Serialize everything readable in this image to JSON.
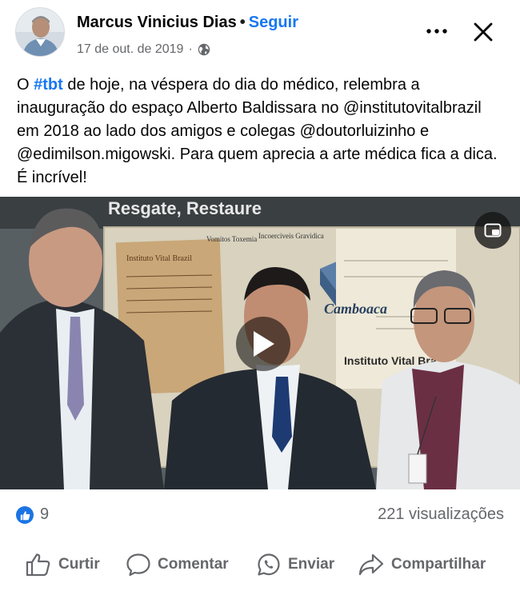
{
  "post": {
    "author": "Marcus Vinicius Dias",
    "separator": "•",
    "follow_label": "Seguir",
    "date": "17 de out. de 2019",
    "date_separator": "·",
    "privacy_icon": "globe-icon",
    "text_before_hashtag": "O ",
    "hashtag": "#tbt",
    "text_after_hashtag": " de hoje, na véspera do dia do médico, relembra a inauguração do espaço Alberto Baldissara no @institutovitalbrazil em 2018 ao lado dos amigos e colegas @doutorluizinho e @edimilson.migowski. Para quem aprecia a arte médica fica a dica. É incrível!"
  },
  "video": {
    "banner_text": "Resgate, Restaure",
    "poster_text_1": "Instituto Vital Brazil",
    "poster_text_2": "Vomitos Toxemia",
    "poster_text_3": "Incoerciveis Gravidica",
    "poster_text_4": "Camboaca",
    "poster_text_5": "Instituto Vital Bra"
  },
  "stats": {
    "like_count": "9",
    "views": "221 visualizações"
  },
  "actions": {
    "like": "Curtir",
    "comment": "Comentar",
    "send": "Enviar",
    "share": "Compartilhar"
  },
  "colors": {
    "accent": "#1877f2",
    "secondary_text": "#65676b",
    "like_badge": "#1b74e4"
  }
}
